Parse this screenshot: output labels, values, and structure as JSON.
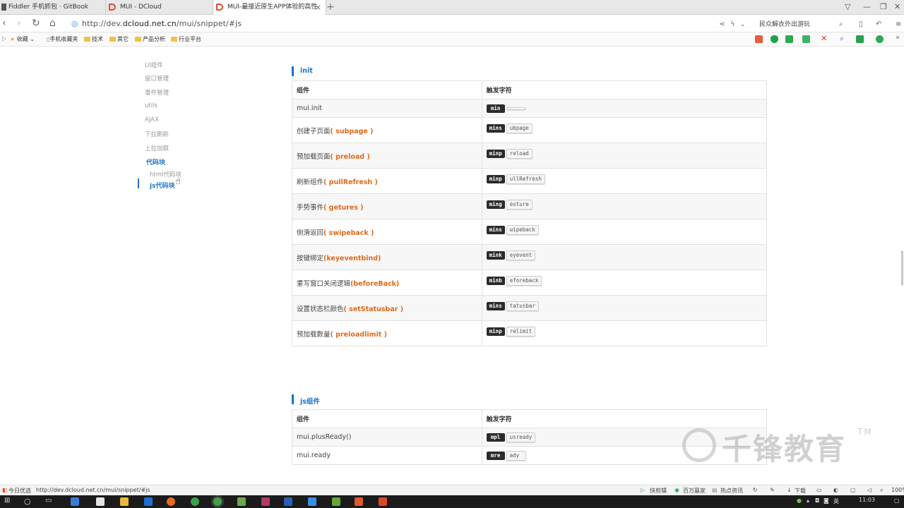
{
  "tabs": [
    {
      "label": "Fiddler 手机抓包 · GitBook"
    },
    {
      "label": "MUI - DCloud"
    },
    {
      "label": "MUI-最接近原生APP体验的高性",
      "close": "×"
    }
  ],
  "new_tab": "+",
  "address": {
    "prefix": "http://dev.",
    "domain": "dcloud.net.cn",
    "path": "/mui/snippet/#js"
  },
  "search_text": "民众解衣外出游玩",
  "bookmarks": [
    "收藏",
    "手机收藏夹",
    "技术",
    "其它",
    "产品分析",
    "行业平台"
  ],
  "sidebar": {
    "items": [
      "UI组件",
      "窗口管理",
      "事件管理",
      "utils",
      "AJAX",
      "下拉刷新",
      "上拉加载"
    ],
    "active": "代码块",
    "sub_items": [
      "html代码块",
      "js代码块"
    ]
  },
  "sections": [
    {
      "title": "init",
      "headers": [
        "组件",
        "触发字符"
      ],
      "rows": [
        {
          "label": "mui.init",
          "hint": "",
          "key": "min",
          "rest": ""
        },
        {
          "label": "创建子页面",
          "hint": "( subpage )",
          "key": "mins",
          "rest": "ubpage"
        },
        {
          "label": "预加载页面",
          "hint": "( preload )",
          "key": "minp",
          "rest": "reload"
        },
        {
          "label": "刷新组件",
          "hint": "( pullRefresh )",
          "key": "minp",
          "rest": "ullRefresh"
        },
        {
          "label": "手势事件",
          "hint": "( getures )",
          "key": "ming",
          "rest": "esture"
        },
        {
          "label": "侧滑返回",
          "hint": "( swipeback )",
          "key": "mins",
          "rest": "wipeback"
        },
        {
          "label": "按键绑定",
          "hint": "(keyeventbind)",
          "key": "mink",
          "rest": "eyevent"
        },
        {
          "label": "重写窗口关闭逻辑",
          "hint": "(beforeBack)",
          "key": "minb",
          "rest": "eforeback"
        },
        {
          "label": "设置状态栏颜色",
          "hint": "( setStatusbar )",
          "key": "mins",
          "rest": "tatusbar"
        },
        {
          "label": "预加载数量",
          "hint": "( preloadlimit )",
          "key": "minp",
          "rest": "relimit"
        }
      ]
    },
    {
      "title": "js组件",
      "headers": [
        "组件",
        "触发字符"
      ],
      "rows": [
        {
          "label": "mui.plusReady()",
          "hint": "",
          "key": "mpl",
          "rest": "usready"
        },
        {
          "label": "mui.ready",
          "hint": "",
          "key": "mre",
          "rest": "ady"
        }
      ]
    }
  ],
  "statusbar": {
    "left_label": "今日优选",
    "url": "http://dev.dcloud.net.cn/mui/snippet/#js",
    "right_items": [
      "快剪辑",
      "百万赢家",
      "热点资讯",
      "下载",
      "100%"
    ]
  },
  "taskbar": {
    "time": "11:03",
    "lang": "英"
  },
  "watermark": {
    "text": "千锋教育",
    "tm": "TM"
  }
}
